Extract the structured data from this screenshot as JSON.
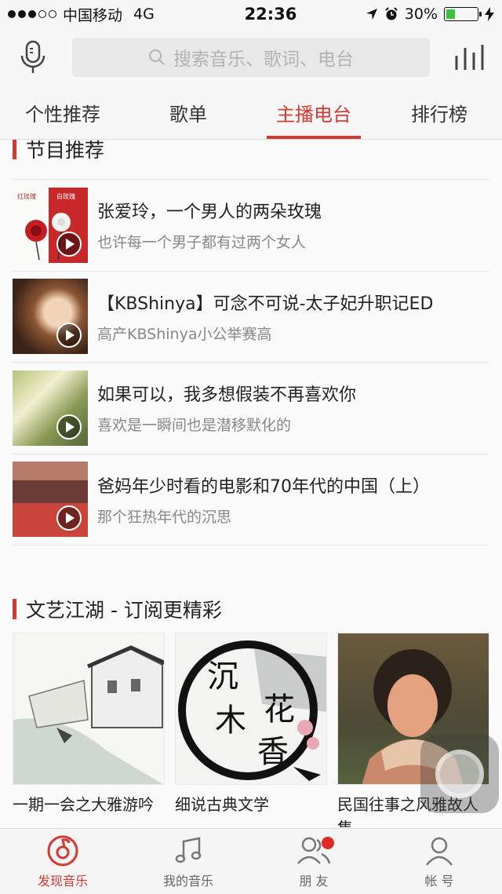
{
  "status_bar": {
    "carrier": "中国移动",
    "network": "4G",
    "time": "22:36",
    "battery_percent": "30%",
    "battery_level": 0.3
  },
  "header": {
    "search_placeholder": "搜索音乐、歌词、电台"
  },
  "tabs": [
    {
      "label": "个性推荐",
      "active": false
    },
    {
      "label": "歌单",
      "active": false
    },
    {
      "label": "主播电台",
      "active": true
    },
    {
      "label": "排行榜",
      "active": false
    }
  ],
  "section_programs": {
    "title": "节目推荐",
    "items": [
      {
        "title": "张爱玲，一个男人的两朵玫瑰",
        "subtitle": "也许每一个男子都有过两个女人"
      },
      {
        "title": "【KBShinya】可念不可说-太子妃升职记ED",
        "subtitle": "高产KBShinya小公举赛高"
      },
      {
        "title": "如果可以，我多想假装不再喜欢你",
        "subtitle": "喜欢是一瞬间也是潜移默化的"
      },
      {
        "title": "爸妈年少时看的电影和70年代的中国（上）",
        "subtitle": "那个狂热年代的沉思"
      }
    ]
  },
  "section_radio": {
    "title": "文艺江湖 - 订阅更精彩",
    "cards": [
      {
        "label": "一期一会之大雅游吟"
      },
      {
        "label": "细说古典文学",
        "art_text": [
          "沉",
          "木",
          "花",
          "香"
        ]
      },
      {
        "label": "民国往事之风雅故人集"
      }
    ]
  },
  "bottom_nav": [
    {
      "label": "发现音乐",
      "icon": "discover-music-icon",
      "active": true
    },
    {
      "label": "我的音乐",
      "icon": "music-note-icon",
      "active": false
    },
    {
      "label": "朋 友",
      "icon": "friends-icon",
      "active": false,
      "badge": true
    },
    {
      "label": "帐 号",
      "icon": "account-icon",
      "active": false
    }
  ],
  "colors": {
    "accent": "#d33a31",
    "badge": "#e02a2a"
  }
}
